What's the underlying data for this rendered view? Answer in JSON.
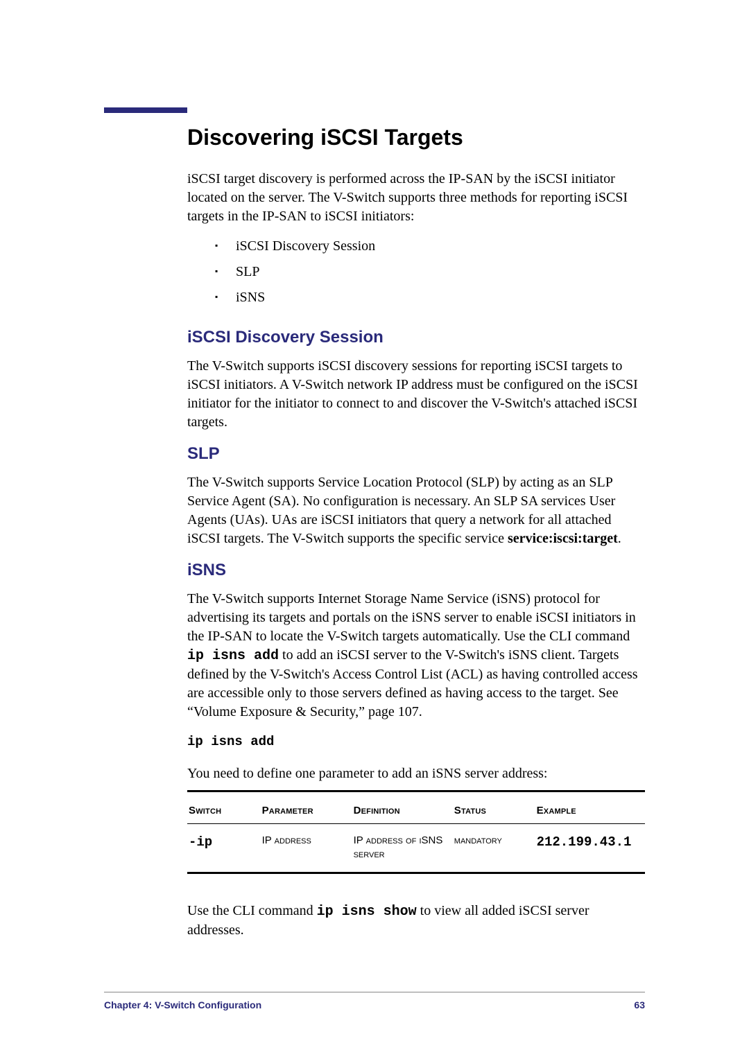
{
  "title": "Discovering iSCSI Targets",
  "intro": "iSCSI target discovery is performed across the IP-SAN by the iSCSI initiator located on the server.  The V-Switch supports three methods for reporting iSCSI targets in the IP-SAN to iSCSI initiators:",
  "bullets": {
    "b1": "iSCSI Discovery Session",
    "b2": "SLP",
    "b3": "iSNS"
  },
  "sections": {
    "discovery": {
      "heading": "iSCSI Discovery Session",
      "body": "The V-Switch supports iSCSI discovery sessions for reporting iSCSI targets to iSCSI initiators.  A V-Switch network IP address must be configured on the iSCSI initiator for the initiator to connect to and discover the V-Switch's attached iSCSI targets."
    },
    "slp": {
      "heading": "SLP",
      "body_pre": "The V-Switch supports Service Location Protocol (SLP) by acting as an SLP Service Agent (SA).  No configuration is necessary.  An SLP SA services User Agents (UAs).  UAs are iSCSI initiators that query a network for all attached iSCSI targets.  The V-Switch supports the specific service ",
      "body_bold": "service:iscsi:target",
      "body_post": "."
    },
    "isns": {
      "heading": "iSNS",
      "body_pre": "The V-Switch supports Internet Storage Name Service (iSNS) protocol for advertising its targets and portals on the iSNS server to enable iSCSI initiators in the IP-SAN to locate the V-Switch targets automatically.  Use the CLI command ",
      "body_code": "ip isns add",
      "body_post": " to add an iSCSI server to the V-Switch's iSNS client.  Targets defined by the V-Switch's Access Control List (ACL) as having controlled access are accessible only to those servers defined as having access to the target.  See “Volume Exposure & Security,” page 107.",
      "cmd": "ip isns add",
      "param_intro": "You need to define one parameter to add an iSNS server address:",
      "table": {
        "headers": {
          "switch": "Switch",
          "parameter": "Parameter",
          "definition": "Definition",
          "status": "Status",
          "example": "Example"
        },
        "row": {
          "switch": "-ip",
          "parameter": "IP address",
          "definition": "IP address of iSNS server",
          "status": "mandatory",
          "example": "212.199.43.1"
        }
      },
      "outro_pre": "Use the CLI command ",
      "outro_code": "ip isns show",
      "outro_post": " to view all added iSCSI server addresses."
    }
  },
  "footer": {
    "left": "Chapter 4:  V-Switch Configuration",
    "right": "63"
  }
}
